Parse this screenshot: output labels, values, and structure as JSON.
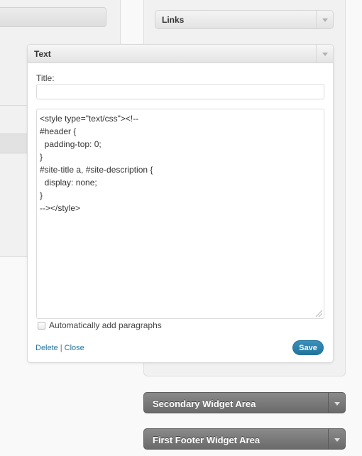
{
  "links_widget": {
    "title": "Links"
  },
  "text_widget": {
    "title": "Text",
    "title_field_label": "Title:",
    "title_value": "",
    "content_lines": [
      "<style type=\"text/css\"><!--",
      "#header {",
      "  padding-top: 0;",
      "}",
      "#site-title a, #site-description {",
      "  display: none;",
      "}",
      "--></style>"
    ],
    "autop_label": "Automatically add paragraphs",
    "autop_checked": false,
    "delete_label": "Delete",
    "link_separator": "|",
    "close_label": "Close",
    "save_label": "Save"
  },
  "widget_areas": [
    {
      "title": "Secondary Widget Area"
    },
    {
      "title": "First Footer Widget Area"
    }
  ],
  "icons": {
    "toggle": "chevron-down-icon",
    "resize": "resize-grip-icon"
  },
  "colors": {
    "link": "#21759b",
    "save_button": "#21759b",
    "dark_sidebar": "#6a6a6a"
  }
}
